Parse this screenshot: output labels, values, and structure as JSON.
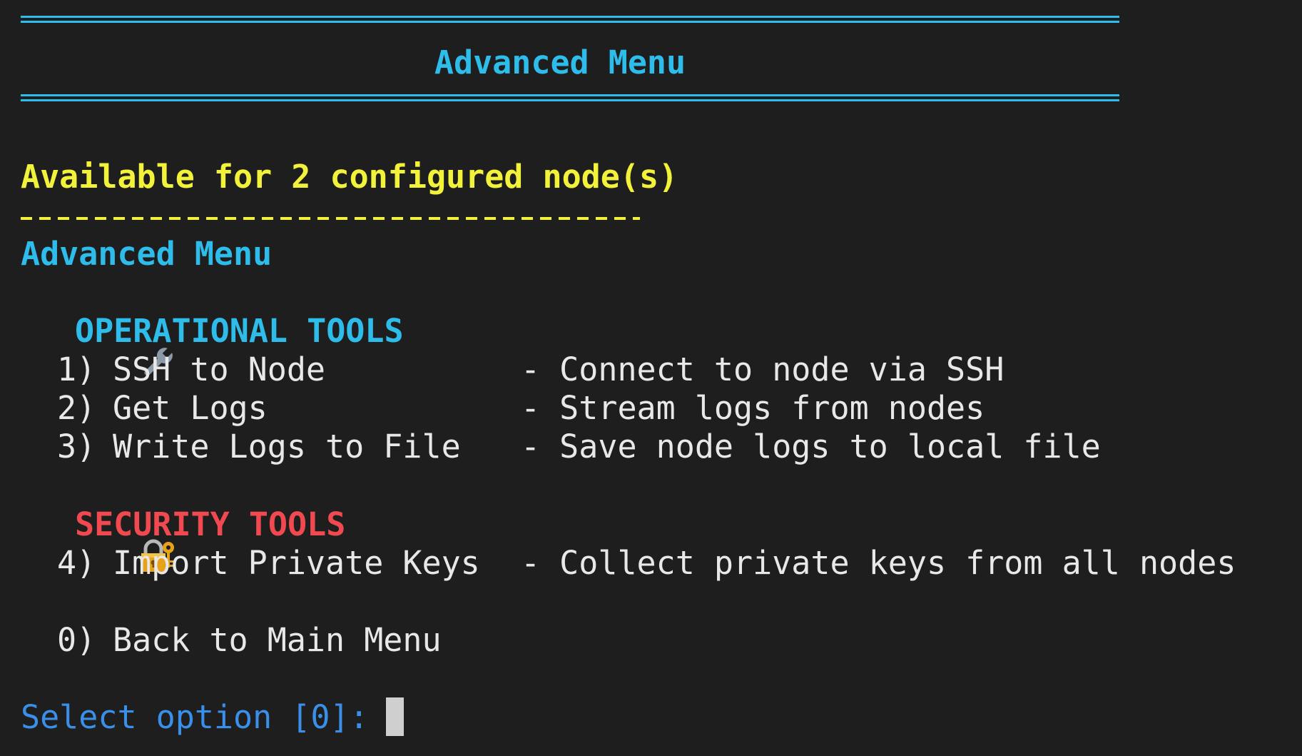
{
  "header": {
    "title": "Advanced Menu"
  },
  "availability": "Available for 2 configured node(s)",
  "subheading": "Advanced Menu",
  "sections": {
    "operational": {
      "icon": "wrench-icon",
      "title": "OPERATIONAL TOOLS",
      "color": "#2ebdea",
      "options": [
        {
          "num": "1)",
          "label": "SSH to Node",
          "desc": "- Connect to node via SSH"
        },
        {
          "num": "2)",
          "label": "Get Logs",
          "desc": "- Stream logs from nodes"
        },
        {
          "num": "3)",
          "label": "Write Logs to File",
          "desc": "- Save node logs to local file"
        }
      ]
    },
    "security": {
      "icon": "lock-key-icon",
      "title": "SECURITY TOOLS",
      "color": "#f04a50",
      "options": [
        {
          "num": "4)",
          "label": "Import Private Keys",
          "desc": "- Collect private keys from all nodes"
        }
      ]
    }
  },
  "back": {
    "num": "0)",
    "label": "Back to Main Menu"
  },
  "prompt": "Select option [0]:",
  "colors": {
    "background": "#1e1e1e",
    "cyan": "#2ebdea",
    "yellow": "#f2f23a",
    "red": "#f04a50",
    "prompt_blue": "#3a8fe8"
  }
}
